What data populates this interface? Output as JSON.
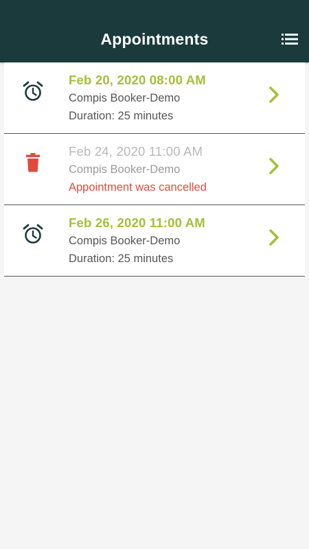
{
  "header": {
    "title": "Appointments",
    "menu_icon": "list-icon"
  },
  "colors": {
    "header_bg": "#1b3a3b",
    "accent_green": "#a2c037",
    "cancelled_red": "#e24a3b",
    "icon_dark": "#1b3a3b"
  },
  "appointments": [
    {
      "date": "Feb 20, 2020 08:00 AM",
      "place": "Compis Booker-Demo",
      "detail": "Duration: 25 minutes",
      "icon": "alarm-clock-icon",
      "status": "active"
    },
    {
      "date": "Feb 24, 2020 11:00 AM",
      "place": "Compis Booker-Demo",
      "detail": "Appointment was cancelled",
      "icon": "trash-icon",
      "status": "cancelled"
    },
    {
      "date": "Feb 26, 2020 11:00 AM",
      "place": "Compis Booker-Demo",
      "detail": "Duration: 25 minutes",
      "icon": "alarm-clock-icon",
      "status": "active"
    }
  ]
}
